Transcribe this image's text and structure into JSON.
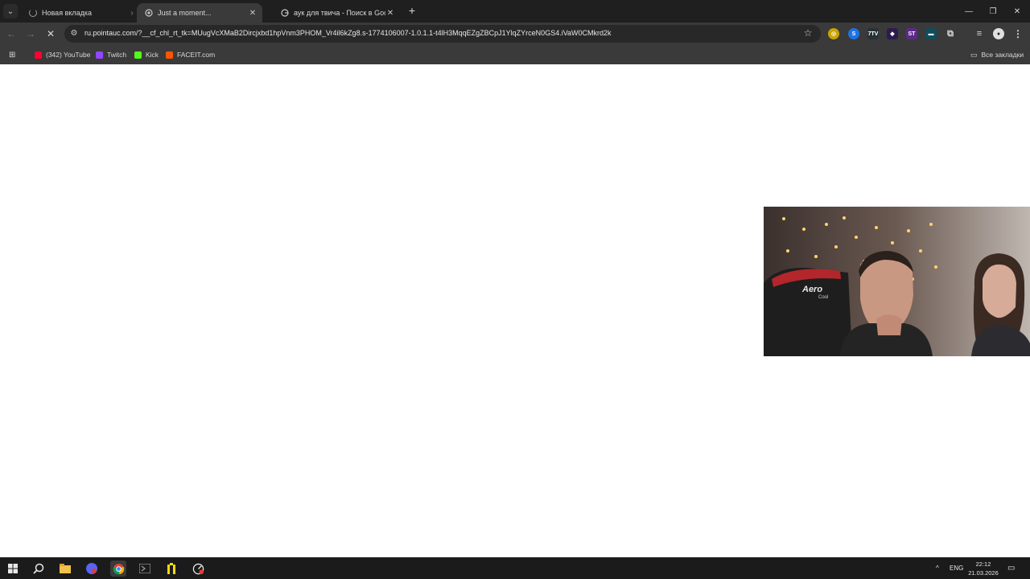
{
  "browser": {
    "tabs": [
      {
        "title": "Новая вкладка",
        "state": "loading"
      },
      {
        "title": "Just a moment...",
        "state": "active"
      },
      {
        "title": "аук для твича - Поиск в Google",
        "state": "normal"
      }
    ],
    "url": "ru.pointauc.com/?__cf_chl_rt_tk=MUugVcXMaB2Dircjxbd1hpVnm3PHOM_Vr4il6kZg8.s-1774106007-1.0.1.1-t4lH3MqqEZgZBCpJ1YlqZYrceN0GS4.iVaW0CMkrd2k",
    "bookmarks": [
      {
        "label": "(342) YouTube",
        "icon": "youtube-icon",
        "color": "#ff0033"
      },
      {
        "label": "Twitch",
        "icon": "twitch-icon",
        "color": "#9146ff"
      },
      {
        "label": "Kick",
        "icon": "kick-icon",
        "color": "#53fc18"
      },
      {
        "label": "FACEIT.com",
        "icon": "faceit-icon",
        "color": "#ff5500"
      }
    ],
    "all_bookmarks_label": "Все закладки"
  },
  "taskbar": {
    "language": "ENG",
    "time": "22:12",
    "date": "21.03.2026"
  },
  "webcam": {
    "chair_brand": "Aero",
    "chair_brand_sub": "Cool"
  }
}
